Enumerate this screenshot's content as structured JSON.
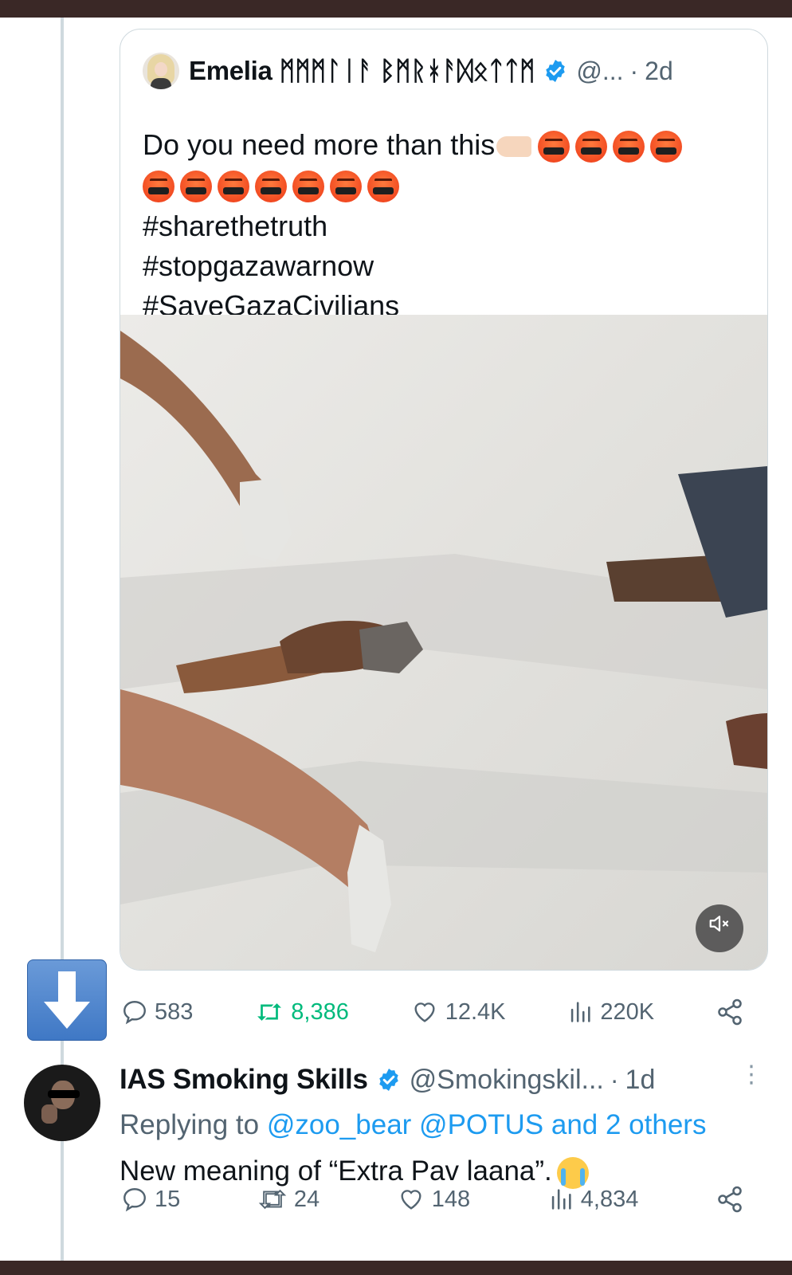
{
  "quoted_tweet": {
    "author_name": "Emelia ᛗᛗᛗᛚᛁᚨ ᛒᛗᚱᚼᚨᛞᛟᛏᛏᛗ",
    "verified": true,
    "handle": "@...",
    "separator": "·",
    "time": "2d",
    "text_line1": "Do you need more than this",
    "hashtags": [
      "#sharethetruth",
      "#stopgazawarnow",
      "#SaveGazaCivilians"
    ],
    "emoji_first_line": "face-with-symbols-on-mouth x4",
    "emoji_second_line": "face-with-symbols-on-mouth x7",
    "media_mute_icon": "volume-muted-icon",
    "stats": {
      "replies": "583",
      "retweets": "8,386",
      "likes": "12.4K",
      "views": "220K"
    }
  },
  "reply_tweet": {
    "author_name": "IAS Smoking Skills",
    "verified": true,
    "handle": "@Smokingskil...",
    "separator": "·",
    "time": "1d",
    "replying_prefix": "Replying to",
    "replying_users": "@zoo_bear @POTUS and 2 others",
    "text": "New meaning of “Extra Pav laana”.",
    "stats": {
      "replies": "15",
      "retweets": "24",
      "likes": "148",
      "views": "4,834"
    }
  },
  "colors": {
    "frame": "#3a2826",
    "accent_blue": "#1d9bf0",
    "retweet_green": "#00ba7c",
    "secondary_text": "#536471"
  }
}
